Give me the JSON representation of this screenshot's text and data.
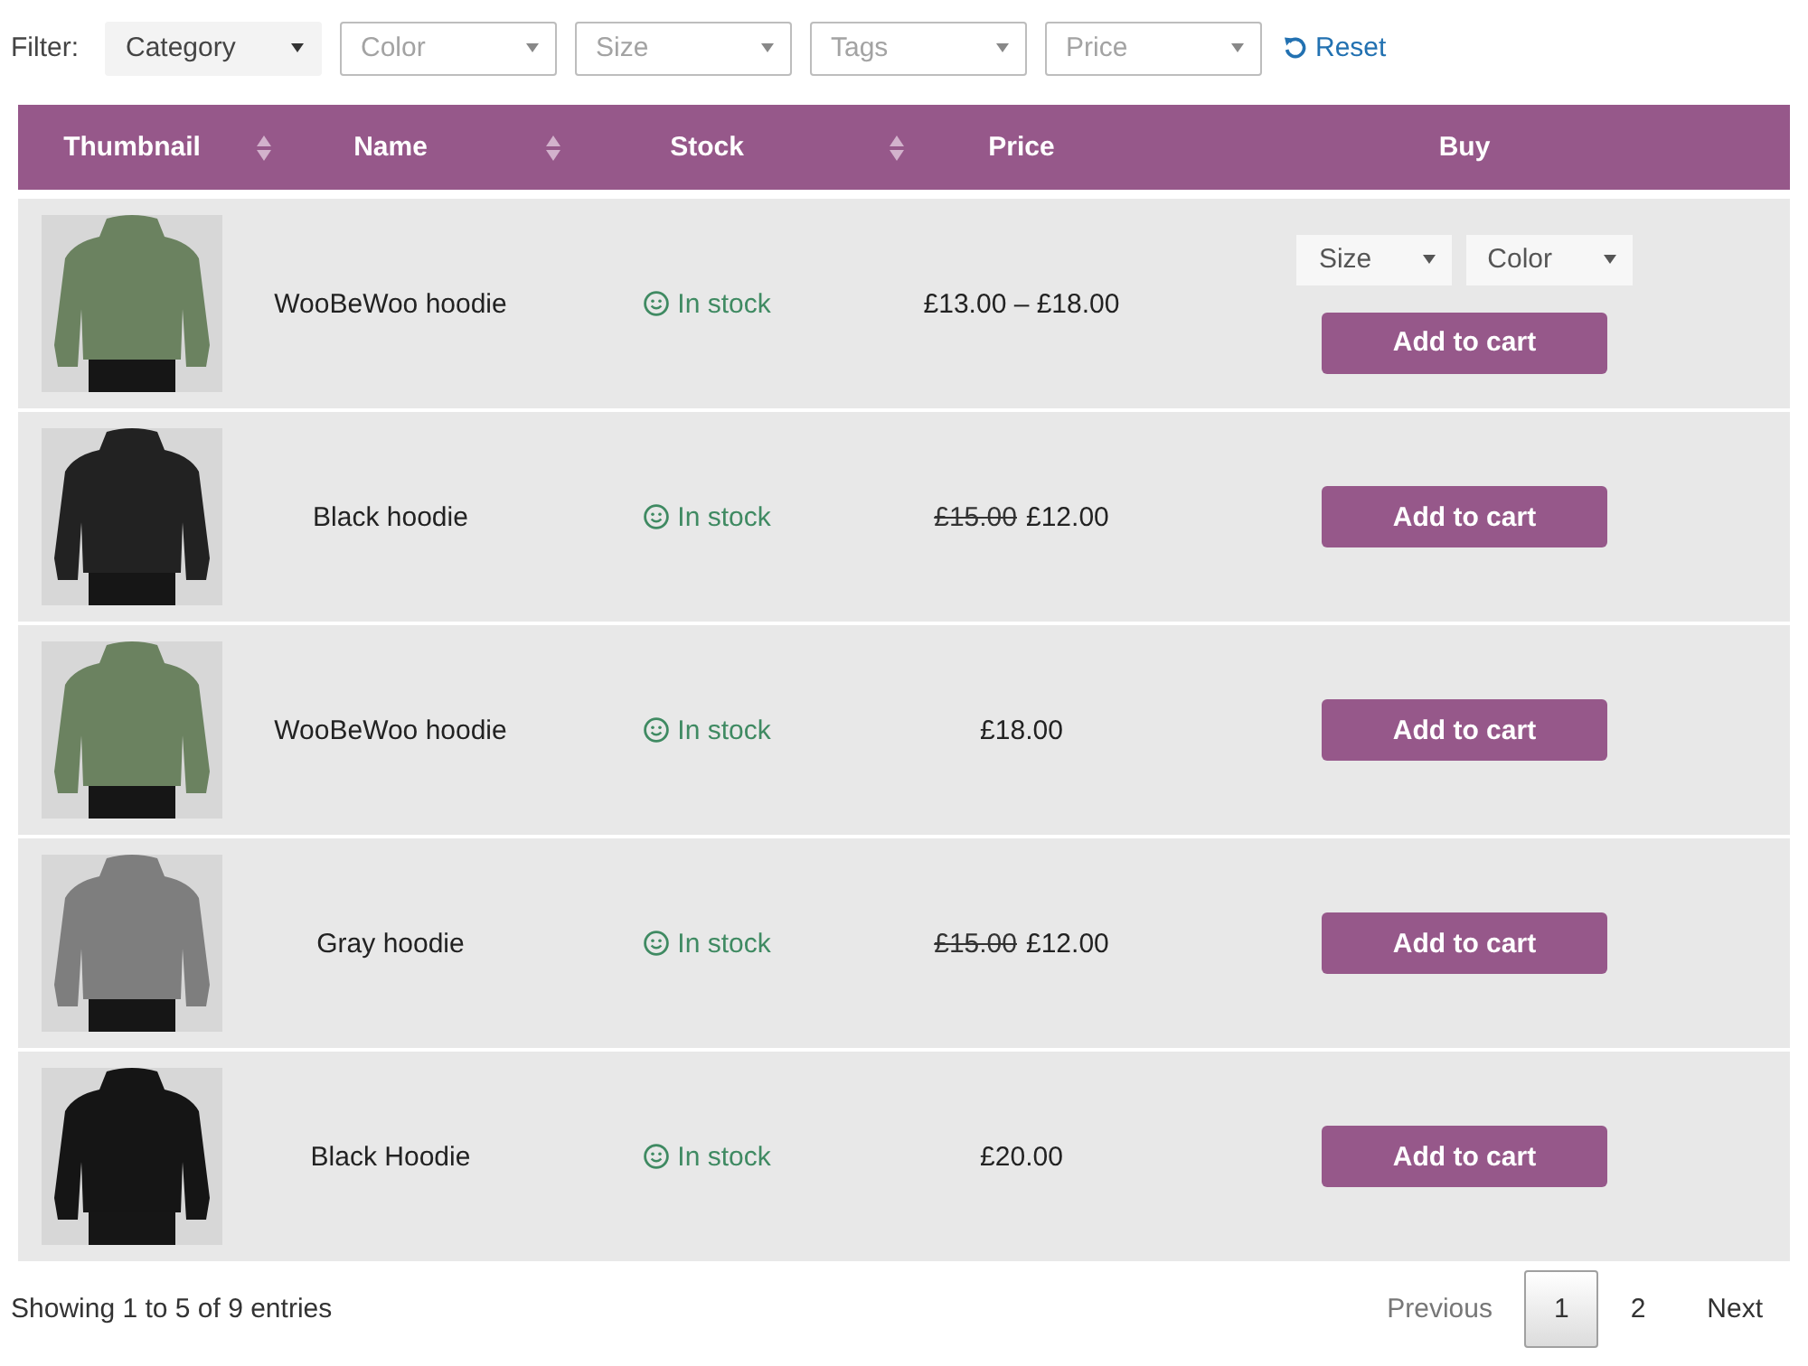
{
  "filter": {
    "label": "Filter:",
    "dropdowns": [
      {
        "label": "Category",
        "active": true
      },
      {
        "label": "Color",
        "active": false
      },
      {
        "label": "Size",
        "active": false
      },
      {
        "label": "Tags",
        "active": false
      },
      {
        "label": "Price",
        "active": false
      }
    ],
    "reset": "Reset"
  },
  "table": {
    "columns": [
      {
        "label": "Thumbnail",
        "sortable": true
      },
      {
        "label": "Name",
        "sortable": true
      },
      {
        "label": "Stock",
        "sortable": true
      },
      {
        "label": "Price",
        "sortable": false
      },
      {
        "label": "Buy",
        "sortable": false
      }
    ],
    "rows": [
      {
        "thumbnail": {
          "color": "#6b8260"
        },
        "name": "WooBeWoo hoodie",
        "stock": "In stock",
        "price": "£13.00 – £18.00",
        "options": [
          {
            "label": "Size"
          },
          {
            "label": "Color"
          }
        ],
        "button": "Add to cart"
      },
      {
        "thumbnail": {
          "color": "#222222"
        },
        "name": "Black hoodie",
        "stock": "In stock",
        "old_price": "£15.00",
        "price": "£12.00",
        "button": "Add to cart"
      },
      {
        "thumbnail": {
          "color": "#6b8260"
        },
        "name": "WooBeWoo hoodie",
        "stock": "In stock",
        "price": "£18.00",
        "button": "Add to cart"
      },
      {
        "thumbnail": {
          "color": "#7e7e7e"
        },
        "name": "Gray hoodie",
        "stock": "In stock",
        "old_price": "£15.00",
        "price": "£12.00",
        "button": "Add to cart"
      },
      {
        "thumbnail": {
          "color": "#151515"
        },
        "name": "Black Hoodie",
        "stock": "In stock",
        "price": "£20.00",
        "button": "Add to cart"
      }
    ]
  },
  "footer": {
    "info": "Showing 1 to 5 of 9 entries",
    "pagination": {
      "previous": {
        "label": "Previous",
        "disabled": true
      },
      "pages": [
        {
          "label": "1",
          "selected": true
        },
        {
          "label": "2",
          "selected": false
        }
      ],
      "next": {
        "label": "Next",
        "disabled": false
      }
    }
  }
}
